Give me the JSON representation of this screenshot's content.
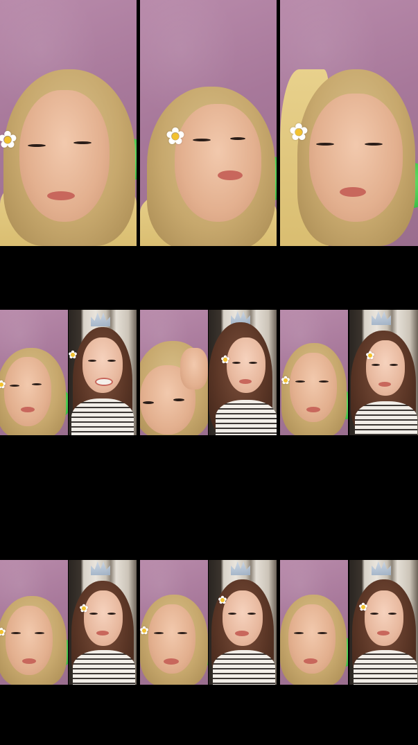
{
  "screen": {
    "description_text": "",
    "background": "#000000"
  },
  "icons": {
    "flower_glyph": "✿"
  },
  "colors": {
    "wall": "#a7789a",
    "hair_blonde": "#c7a86d",
    "hair_brown": "#5b3626",
    "pillow_green": "#3fbf48",
    "flower_center": "#f2c230"
  }
}
